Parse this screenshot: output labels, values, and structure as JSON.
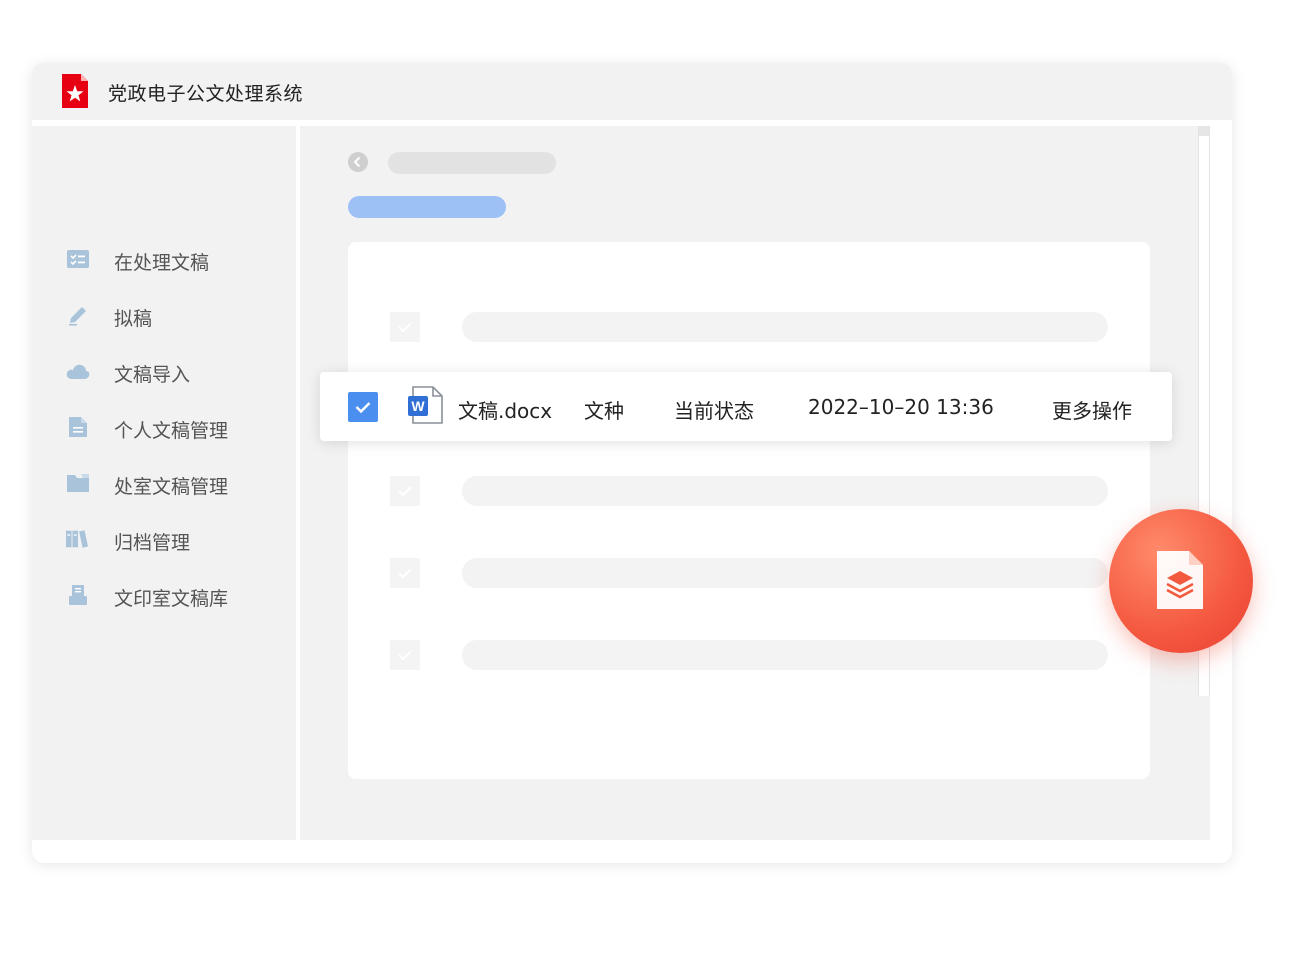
{
  "app": {
    "title": "党政电子公文处理系统",
    "accent_color": "#4a8ff0",
    "brand_color": "#e60012"
  },
  "sidebar": {
    "items": [
      {
        "label": "在处理文稿",
        "icon": "checklist-icon"
      },
      {
        "label": "拟稿",
        "icon": "pencil-icon"
      },
      {
        "label": "文稿导入",
        "icon": "cloud-icon"
      },
      {
        "label": "个人文稿管理",
        "icon": "document-icon"
      },
      {
        "label": "处室文稿管理",
        "icon": "folder-icon"
      },
      {
        "label": "归档管理",
        "icon": "archive-books-icon"
      },
      {
        "label": "文印室文稿库",
        "icon": "printer-icon"
      }
    ]
  },
  "row": {
    "filename": "文稿.docx",
    "doc_type": "文种",
    "status": "当前状态",
    "datetime": "2022–10–20 13:36",
    "more": "更多操作",
    "file_icon": "word-file-icon",
    "checked": true
  },
  "fab": {
    "icon": "document-layers-icon"
  }
}
